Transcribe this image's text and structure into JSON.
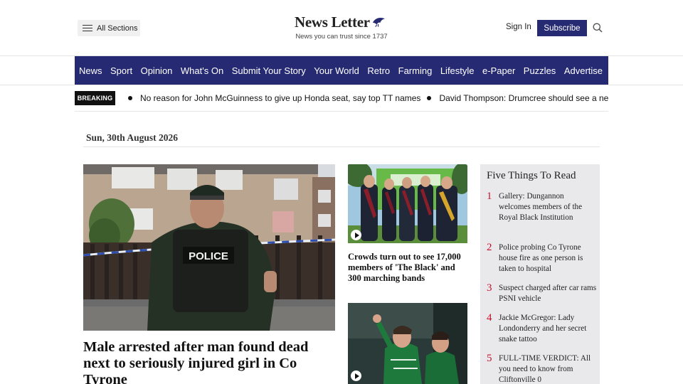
{
  "header": {
    "sections_label": "All Sections",
    "logo_text": "News Letter",
    "tagline": "News you can trust since 1737",
    "signin_label": "Sign In",
    "subscribe_label": "Subscribe",
    "search_icon": "search-icon",
    "brand_color": "#262a72"
  },
  "nav": {
    "items": [
      "News",
      "Sport",
      "Opinion",
      "What's On",
      "Submit Your Story",
      "Your World",
      "Retro",
      "Farming",
      "Lifestyle",
      "e-Paper",
      "Puzzles",
      "Advertise"
    ]
  },
  "breaking": {
    "badge": "BREAKING",
    "items": [
      "No reason for John McGuinness to give up Honda seat, say top TT names",
      "David Thompson: Drumcree should see a new generation"
    ]
  },
  "date": "Sun, 30th August 2026",
  "main_story": {
    "headline": "Male arrested after man found dead next to seriously injured girl in Co Tyrone",
    "image_text": "POLICE"
  },
  "mid_stories": [
    {
      "headline": "Crowds turn out to see 17,000 members of 'The Black' and 300 marching bands",
      "has_video": true
    },
    {
      "headline": "",
      "has_video": true
    }
  ],
  "five_things": {
    "title": "Five Things To Read",
    "accent_color": "#c8102e",
    "items": [
      {
        "num": "1",
        "text": "Gallery: Dungannon welcomes members of the Royal Black Institution"
      },
      {
        "num": "2",
        "text": "Police probing Co Tyrone house fire as one person is taken to hospital"
      },
      {
        "num": "3",
        "text": "Suspect charged after car rams PSNI vehicle"
      },
      {
        "num": "4",
        "text": "Jackie McGregor: Lady Londonderry and her secret snake tattoo"
      },
      {
        "num": "5",
        "text": "FULL-TIME VERDICT: All you need to know from Cliftonville 0"
      }
    ]
  }
}
